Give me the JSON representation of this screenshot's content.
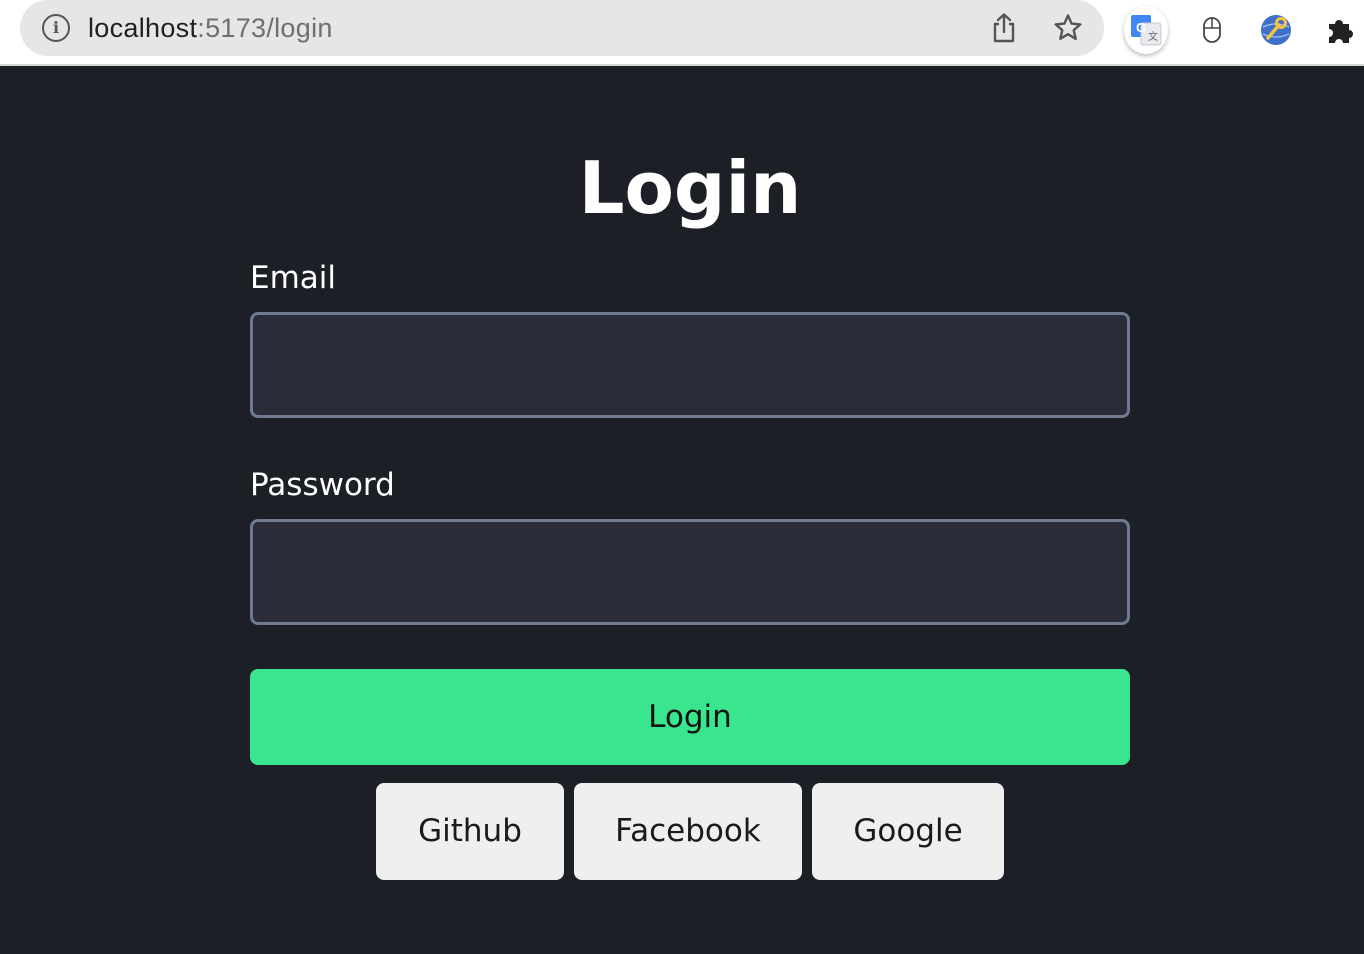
{
  "browser": {
    "url_host": "localhost",
    "url_rest": ":5173/login",
    "icons": {
      "info": "info-icon",
      "share": "share-icon",
      "bookmark": "star-icon",
      "extensions": [
        "google-translate-icon",
        "mouse-icon",
        "globe-key-icon",
        "puzzle-icon"
      ]
    }
  },
  "login": {
    "title": "Login",
    "email_label": "Email",
    "email_value": "",
    "password_label": "Password",
    "password_value": "",
    "submit_label": "Login",
    "social_buttons": [
      "Github",
      "Facebook",
      "Google"
    ]
  },
  "colors": {
    "background": "#1d1f26",
    "input_background": "#2a2d38",
    "input_border": "#6e7b91",
    "primary_button": "#3ae68d",
    "secondary_button": "#efefef"
  }
}
